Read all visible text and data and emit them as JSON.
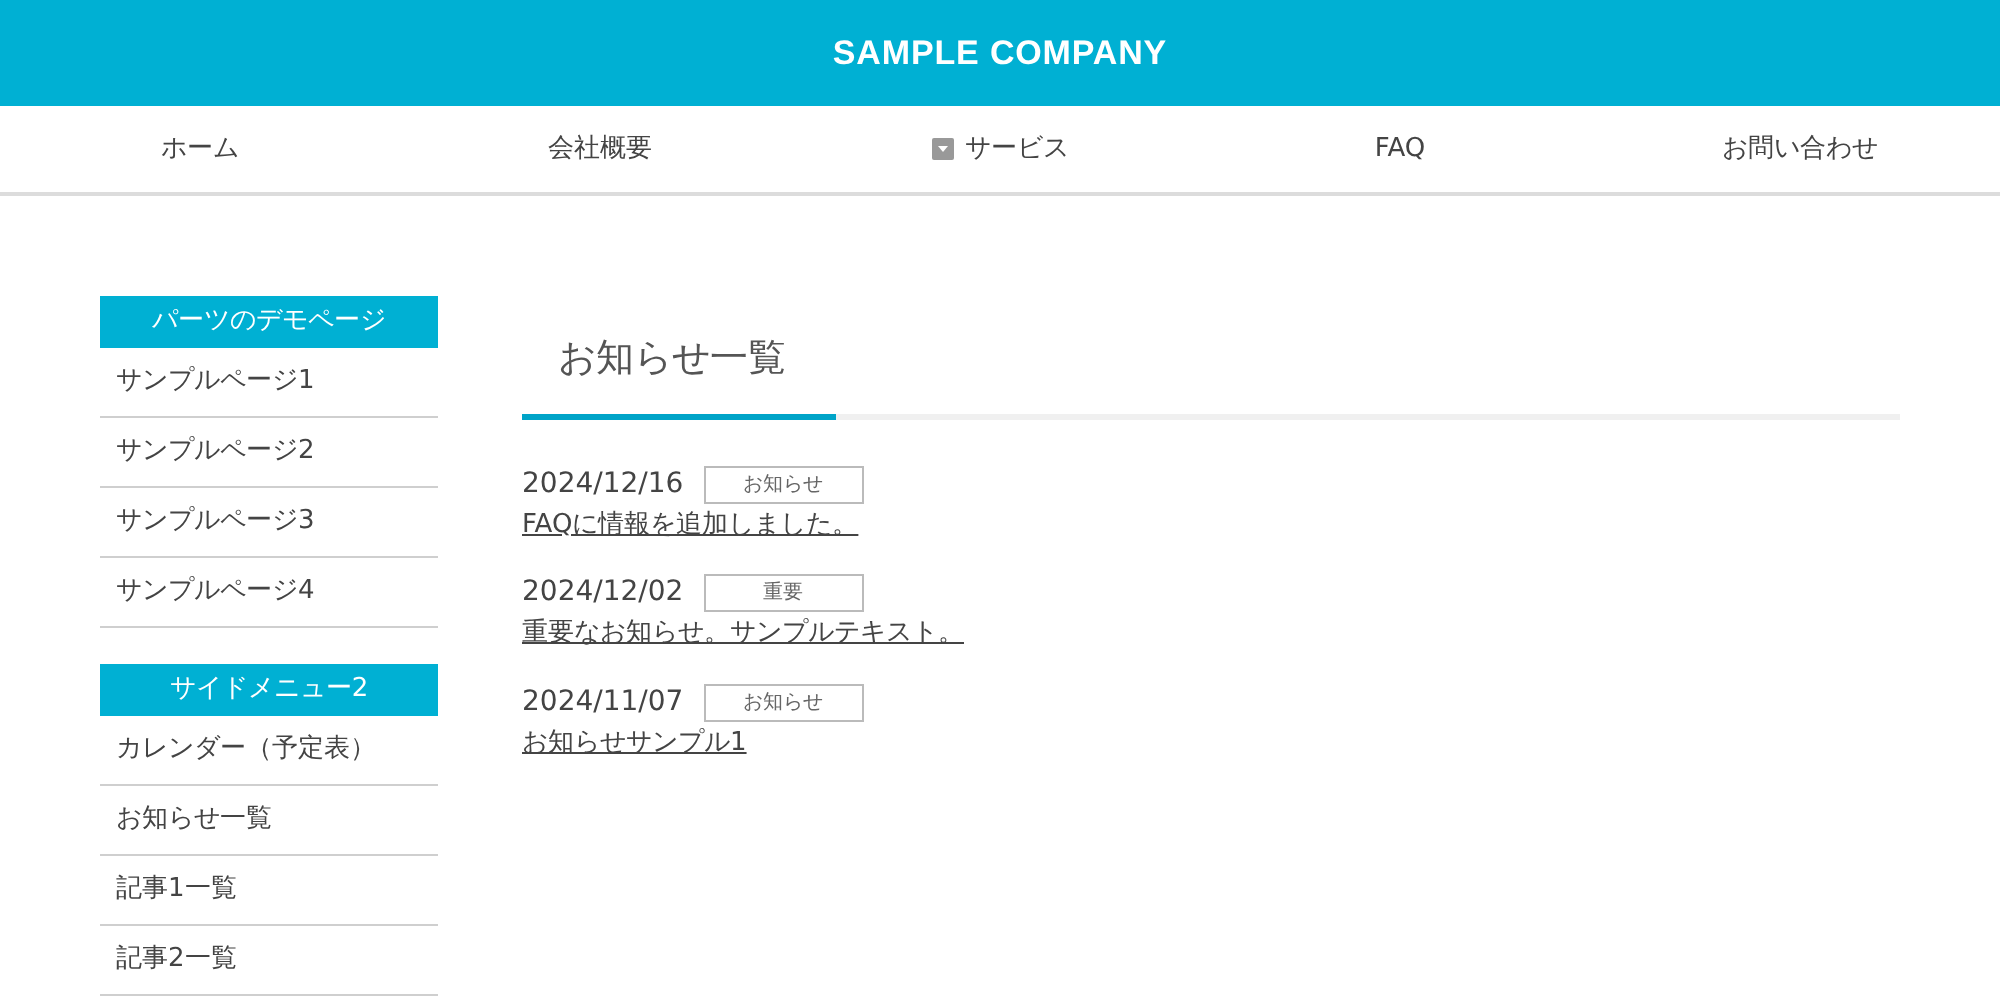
{
  "header": {
    "logo": "SAMPLE COMPANY"
  },
  "nav": [
    {
      "label": "ホーム",
      "has_submenu": false
    },
    {
      "label": "会社概要",
      "has_submenu": false
    },
    {
      "label": "サービス",
      "has_submenu": true
    },
    {
      "label": "FAQ",
      "has_submenu": false
    },
    {
      "label": "お問い合わせ",
      "has_submenu": false
    }
  ],
  "sidebar": [
    {
      "heading": "パーツのデモページ",
      "items": [
        "サンプルページ1",
        "サンプルページ2",
        "サンプルページ3",
        "サンプルページ4"
      ]
    },
    {
      "heading": "サイドメニュー2",
      "items": [
        "カレンダー（予定表）",
        "お知らせ一覧",
        "記事1一覧",
        "記事2一覧"
      ]
    }
  ],
  "main": {
    "title": "お知らせ一覧",
    "news": [
      {
        "date": "2024/12/16",
        "tag": "お知らせ",
        "title": "FAQに情報を追加しました。"
      },
      {
        "date": "2024/12/02",
        "tag": "重要",
        "title": "重要なお知らせ。サンプルテキスト。"
      },
      {
        "date": "2024/11/07",
        "tag": "お知らせ",
        "title": "お知らせサンプル1"
      }
    ]
  }
}
